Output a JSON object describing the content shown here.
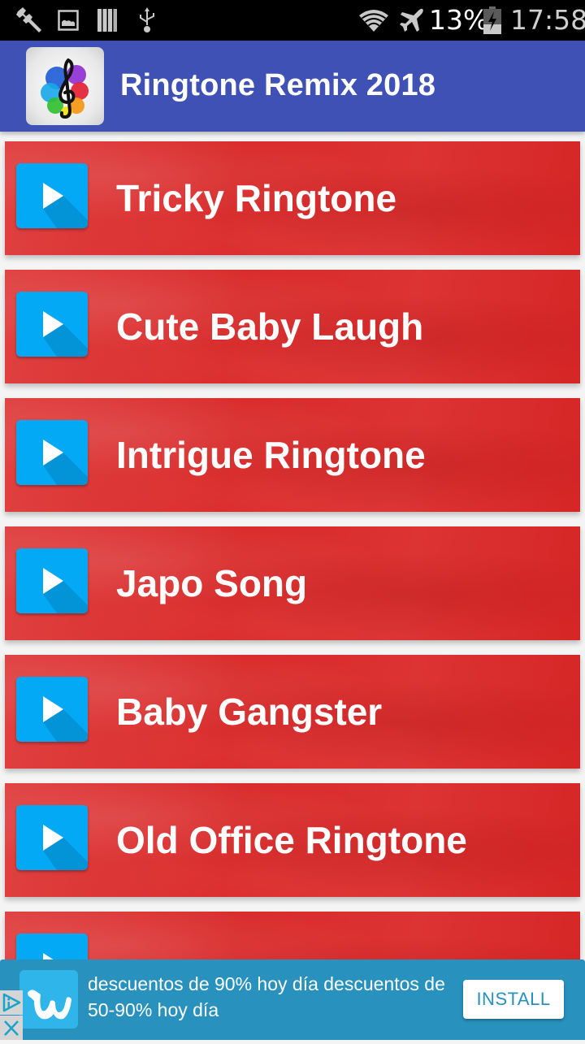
{
  "status_bar": {
    "icons_left": [
      "wrench-icon",
      "image-icon",
      "sd-card-icon",
      "usb-icon"
    ],
    "icons_right": [
      "wifi-icon",
      "airplane-mode-icon",
      "battery-charging-icon"
    ],
    "battery_percent_text": "13%",
    "battery_level": 0.13,
    "time": "17:58"
  },
  "app_bar": {
    "title": "Ringtone Remix 2018",
    "icon": "treble-clef-splash-icon"
  },
  "ringtones": [
    {
      "label": "Tricky Ringtone",
      "icon": "play-icon"
    },
    {
      "label": "Cute Baby Laugh",
      "icon": "play-icon"
    },
    {
      "label": "Intrigue Ringtone",
      "icon": "play-icon"
    },
    {
      "label": "Japo Song",
      "icon": "play-icon"
    },
    {
      "label": "Baby Gangster",
      "icon": "play-icon"
    },
    {
      "label": "Old Office Ringtone",
      "icon": "play-icon"
    },
    {
      "label": "",
      "icon": "play-icon"
    }
  ],
  "ad": {
    "text": "descuentos de 90% hoy día descuentos de 50-90% hoy día",
    "install_label": "INSTALL",
    "logo": "wish-logo-icon",
    "colors": {
      "background": "#2891bd",
      "logo_bg": "#2fb5ea"
    }
  },
  "colors": {
    "app_bar": "#3f51b5",
    "card": "#d92a2a",
    "play_button": "#03a9f4"
  }
}
